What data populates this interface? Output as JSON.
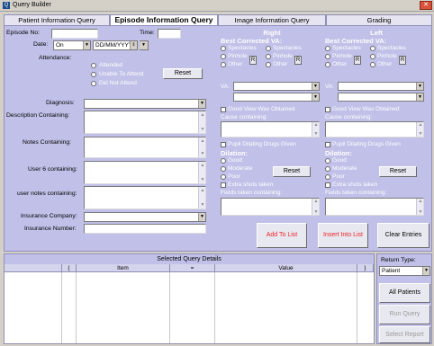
{
  "window": {
    "title": "Query Builder",
    "icon_name": "app-icon",
    "close_glyph": "✕"
  },
  "tabs": [
    {
      "label": "Patient Information Query",
      "active": false
    },
    {
      "label": "Episode Information Query",
      "active": true
    },
    {
      "label": "Image Information Query",
      "active": false
    },
    {
      "label": "Grading",
      "active": false
    }
  ],
  "episode": {
    "episode_no_label": "Episode No:",
    "time_label": "Time:",
    "date_label": "Date:",
    "date_op": "On",
    "date_format": "DD/MM/YYYY",
    "attendance_label": "Attendance:",
    "attendance_options": [
      "Attended",
      "Unable To Attend",
      "Did Not Attend"
    ],
    "reset_label": "Reset",
    "diagnosis_label": "Diagnosis:",
    "description_label": "Description Containing:",
    "notes_label": "Notes Containing:",
    "user6_label": "User 6 containing:",
    "usernotes_label": "user notes containing:",
    "insurance_company_label": "Insurance Company:",
    "insurance_number_label": "Insurance Number:"
  },
  "eyes": {
    "right": {
      "title": "Right",
      "va_title": "Best Corrected VA:",
      "va_options": [
        "Spectacles",
        "Spectacles",
        "Pinhole",
        "Pinhole",
        "Other",
        "Other"
      ],
      "r_label": "R",
      "va_label": "VA:",
      "good_view_label": "Good View Was Obtained",
      "cause_label": "Cause containing:",
      "pupil_label": "Pupil Dilating Drugs Given",
      "dilation_title": "Dilation:",
      "dilation_options": [
        "Good",
        "Moderate",
        "Poor"
      ],
      "extra_shots_label": "Extra shots taken",
      "fields_label": "Fields taken containing:",
      "reset_label": "Reset"
    },
    "left": {
      "title": "Left",
      "va_title": "Best Corrected VA:",
      "va_options": [
        "Spectacles",
        "Spectacles",
        "Pinhole",
        "Pinhole",
        "Other",
        "Other"
      ],
      "r_label": "R",
      "va_label": "VA:",
      "good_view_label": "Good View Was Obtained",
      "cause_label": "Cause containing:",
      "pupil_label": "Pupil Dilating Drugs Given",
      "dilation_title": "Dilation:",
      "dilation_options": [
        "Good",
        "Moderate",
        "Poor"
      ],
      "extra_shots_label": "Extra shots taken",
      "fields_label": "Fields taken containing:",
      "reset_label": "Reset"
    }
  },
  "actions": {
    "add_to_list": "Add To List",
    "insert_into_list": "Insert Into List",
    "clear_entries": "Clear Entries"
  },
  "query_details": {
    "title": "Selected Query Details",
    "columns": [
      "",
      "(",
      "Item",
      "=",
      "Value",
      ")",
      ""
    ]
  },
  "return_type": {
    "label": "Return Type:",
    "value": "Patient",
    "buttons": [
      "All Patients",
      "Run Query",
      "Select Report"
    ]
  },
  "colors": {
    "panel": "#c0c0e8",
    "accent_red": "#ee2222",
    "window": "#d4d0c8"
  }
}
